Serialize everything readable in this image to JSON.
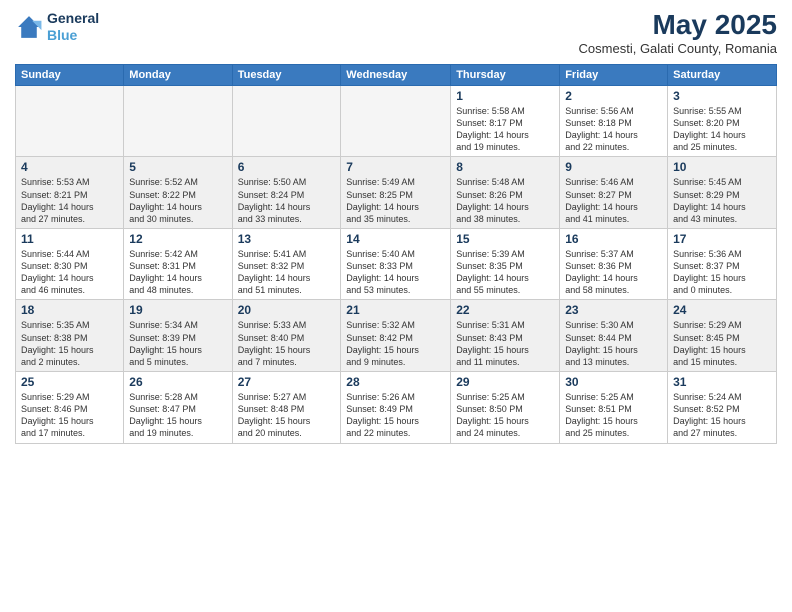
{
  "logo": {
    "line1": "General",
    "line2": "Blue"
  },
  "title": "May 2025",
  "subtitle": "Cosmesti, Galati County, Romania",
  "weekdays": [
    "Sunday",
    "Monday",
    "Tuesday",
    "Wednesday",
    "Thursday",
    "Friday",
    "Saturday"
  ],
  "weeks": [
    [
      {
        "day": "",
        "info": ""
      },
      {
        "day": "",
        "info": ""
      },
      {
        "day": "",
        "info": ""
      },
      {
        "day": "",
        "info": ""
      },
      {
        "day": "1",
        "info": "Sunrise: 5:58 AM\nSunset: 8:17 PM\nDaylight: 14 hours\nand 19 minutes."
      },
      {
        "day": "2",
        "info": "Sunrise: 5:56 AM\nSunset: 8:18 PM\nDaylight: 14 hours\nand 22 minutes."
      },
      {
        "day": "3",
        "info": "Sunrise: 5:55 AM\nSunset: 8:20 PM\nDaylight: 14 hours\nand 25 minutes."
      }
    ],
    [
      {
        "day": "4",
        "info": "Sunrise: 5:53 AM\nSunset: 8:21 PM\nDaylight: 14 hours\nand 27 minutes."
      },
      {
        "day": "5",
        "info": "Sunrise: 5:52 AM\nSunset: 8:22 PM\nDaylight: 14 hours\nand 30 minutes."
      },
      {
        "day": "6",
        "info": "Sunrise: 5:50 AM\nSunset: 8:24 PM\nDaylight: 14 hours\nand 33 minutes."
      },
      {
        "day": "7",
        "info": "Sunrise: 5:49 AM\nSunset: 8:25 PM\nDaylight: 14 hours\nand 35 minutes."
      },
      {
        "day": "8",
        "info": "Sunrise: 5:48 AM\nSunset: 8:26 PM\nDaylight: 14 hours\nand 38 minutes."
      },
      {
        "day": "9",
        "info": "Sunrise: 5:46 AM\nSunset: 8:27 PM\nDaylight: 14 hours\nand 41 minutes."
      },
      {
        "day": "10",
        "info": "Sunrise: 5:45 AM\nSunset: 8:29 PM\nDaylight: 14 hours\nand 43 minutes."
      }
    ],
    [
      {
        "day": "11",
        "info": "Sunrise: 5:44 AM\nSunset: 8:30 PM\nDaylight: 14 hours\nand 46 minutes."
      },
      {
        "day": "12",
        "info": "Sunrise: 5:42 AM\nSunset: 8:31 PM\nDaylight: 14 hours\nand 48 minutes."
      },
      {
        "day": "13",
        "info": "Sunrise: 5:41 AM\nSunset: 8:32 PM\nDaylight: 14 hours\nand 51 minutes."
      },
      {
        "day": "14",
        "info": "Sunrise: 5:40 AM\nSunset: 8:33 PM\nDaylight: 14 hours\nand 53 minutes."
      },
      {
        "day": "15",
        "info": "Sunrise: 5:39 AM\nSunset: 8:35 PM\nDaylight: 14 hours\nand 55 minutes."
      },
      {
        "day": "16",
        "info": "Sunrise: 5:37 AM\nSunset: 8:36 PM\nDaylight: 14 hours\nand 58 minutes."
      },
      {
        "day": "17",
        "info": "Sunrise: 5:36 AM\nSunset: 8:37 PM\nDaylight: 15 hours\nand 0 minutes."
      }
    ],
    [
      {
        "day": "18",
        "info": "Sunrise: 5:35 AM\nSunset: 8:38 PM\nDaylight: 15 hours\nand 2 minutes."
      },
      {
        "day": "19",
        "info": "Sunrise: 5:34 AM\nSunset: 8:39 PM\nDaylight: 15 hours\nand 5 minutes."
      },
      {
        "day": "20",
        "info": "Sunrise: 5:33 AM\nSunset: 8:40 PM\nDaylight: 15 hours\nand 7 minutes."
      },
      {
        "day": "21",
        "info": "Sunrise: 5:32 AM\nSunset: 8:42 PM\nDaylight: 15 hours\nand 9 minutes."
      },
      {
        "day": "22",
        "info": "Sunrise: 5:31 AM\nSunset: 8:43 PM\nDaylight: 15 hours\nand 11 minutes."
      },
      {
        "day": "23",
        "info": "Sunrise: 5:30 AM\nSunset: 8:44 PM\nDaylight: 15 hours\nand 13 minutes."
      },
      {
        "day": "24",
        "info": "Sunrise: 5:29 AM\nSunset: 8:45 PM\nDaylight: 15 hours\nand 15 minutes."
      }
    ],
    [
      {
        "day": "25",
        "info": "Sunrise: 5:29 AM\nSunset: 8:46 PM\nDaylight: 15 hours\nand 17 minutes."
      },
      {
        "day": "26",
        "info": "Sunrise: 5:28 AM\nSunset: 8:47 PM\nDaylight: 15 hours\nand 19 minutes."
      },
      {
        "day": "27",
        "info": "Sunrise: 5:27 AM\nSunset: 8:48 PM\nDaylight: 15 hours\nand 20 minutes."
      },
      {
        "day": "28",
        "info": "Sunrise: 5:26 AM\nSunset: 8:49 PM\nDaylight: 15 hours\nand 22 minutes."
      },
      {
        "day": "29",
        "info": "Sunrise: 5:25 AM\nSunset: 8:50 PM\nDaylight: 15 hours\nand 24 minutes."
      },
      {
        "day": "30",
        "info": "Sunrise: 5:25 AM\nSunset: 8:51 PM\nDaylight: 15 hours\nand 25 minutes."
      },
      {
        "day": "31",
        "info": "Sunrise: 5:24 AM\nSunset: 8:52 PM\nDaylight: 15 hours\nand 27 minutes."
      }
    ]
  ]
}
